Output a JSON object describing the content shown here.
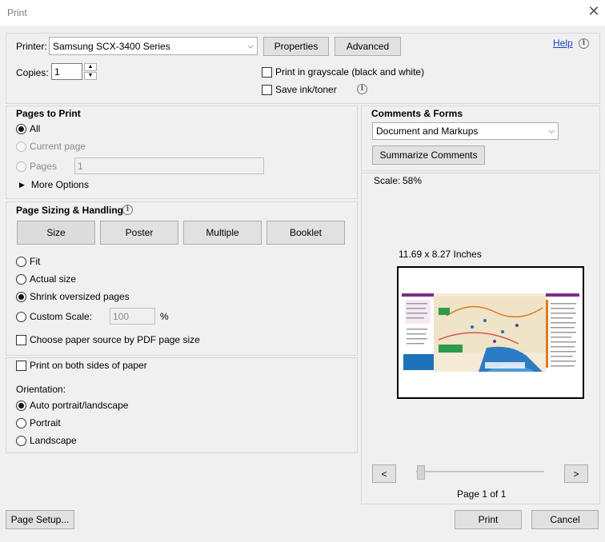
{
  "window": {
    "title": "Print",
    "close_icon": "close-icon"
  },
  "printer": {
    "label": "Printer:",
    "selected": "Samsung SCX-3400 Series",
    "properties_button": "Properties",
    "advanced_button": "Advanced",
    "help_link": "Help"
  },
  "copies": {
    "label": "Copies:",
    "value": "1"
  },
  "options": {
    "grayscale_label": "Print in grayscale (black and white)",
    "save_ink_label": "Save ink/toner"
  },
  "pages_to_print": {
    "header": "Pages to Print",
    "all_label": "All",
    "current_label": "Current page",
    "pages_label": "Pages",
    "pages_value": "1",
    "more_options": "More Options"
  },
  "sizing": {
    "header": "Page Sizing & Handling",
    "tabs": [
      "Size",
      "Poster",
      "Multiple",
      "Booklet"
    ],
    "fit_label": "Fit",
    "actual_label": "Actual size",
    "shrink_label": "Shrink oversized pages",
    "custom_label": "Custom Scale:",
    "custom_value": "100",
    "custom_unit": "%",
    "paper_source_label": "Choose paper source by PDF page size"
  },
  "duplex": {
    "both_sides_label": "Print on both sides of paper"
  },
  "orientation": {
    "header": "Orientation:",
    "auto_label": "Auto portrait/landscape",
    "portrait_label": "Portrait",
    "landscape_label": "Landscape"
  },
  "comments": {
    "header": "Comments & Forms",
    "selected": "Document and Markups",
    "summarize_button": "Summarize Comments"
  },
  "preview": {
    "scale_label": "Scale:",
    "scale_value": "58%",
    "paper_size": "11.69 x 8.27 Inches",
    "prev_button": "<",
    "next_button": ">",
    "page_indicator": "Page 1 of 1"
  },
  "footer": {
    "page_setup_button": "Page Setup...",
    "print_button": "Print",
    "cancel_button": "Cancel"
  },
  "colors": {
    "accent_purple": "#7a2c8c",
    "map_green": "#2e9a4a",
    "map_blue": "#1d73b8",
    "map_orange": "#e07a1f"
  }
}
